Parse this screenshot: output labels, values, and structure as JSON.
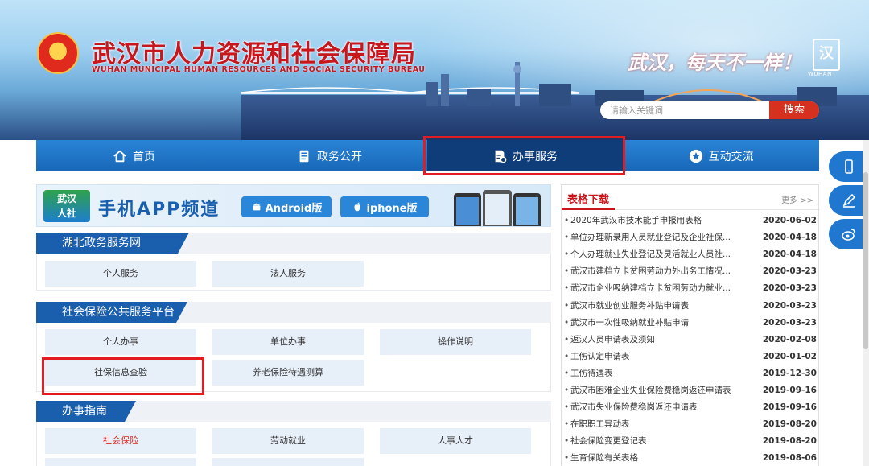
{
  "header": {
    "title": "武汉市人力资源和社会保障局",
    "subtitle": "WUHAN MUNICIPAL HUMAN RESOURCES AND SOCIAL SECURITY BUREAU",
    "slogan": "武汉，每天不一样！",
    "city_logo_text": "WUHAN",
    "search_placeholder": "请输入关键词",
    "search_button": "搜索"
  },
  "nav": {
    "items": [
      {
        "label": "首页",
        "icon": "home-icon"
      },
      {
        "label": "政务公开",
        "icon": "document-icon"
      },
      {
        "label": "办事服务",
        "icon": "service-icon"
      },
      {
        "label": "互动交流",
        "icon": "star-icon"
      }
    ],
    "active_index": 2
  },
  "app_banner": {
    "logo_text_1": "武汉",
    "logo_text_2": "人社",
    "title": "手机APP频道",
    "android_label": "Android版",
    "iphone_label": "iphone版"
  },
  "sections": [
    {
      "title": "湖北政务服务网",
      "tiles": [
        "个人服务",
        "法人服务"
      ]
    },
    {
      "title": "社会保险公共服务平台",
      "tiles": [
        "个人办事",
        "单位办事",
        "操作说明",
        "社保信息查验",
        "养老保险待遇测算"
      ]
    },
    {
      "title": "办事指南",
      "tiles": [
        "社会保险",
        "劳动就业",
        "人事人才"
      ]
    }
  ],
  "downloads": {
    "title": "表格下载",
    "more": "更多 >>",
    "items": [
      {
        "name": "2020年武汉市技术能手申报用表格",
        "date": "2020-06-02"
      },
      {
        "name": "单位办理新录用人员就业登记及企业社保...",
        "date": "2020-04-18"
      },
      {
        "name": "个人办理就业失业登记及灵活就业人员社...",
        "date": "2020-04-18"
      },
      {
        "name": "武汉市建档立卡贫困劳动力外出务工情况...",
        "date": "2020-03-23"
      },
      {
        "name": "武汉市企业吸纳建档立卡贫困劳动力就业...",
        "date": "2020-03-23"
      },
      {
        "name": "武汉市就业创业服务补贴申请表",
        "date": "2020-03-23"
      },
      {
        "name": "武汉市一次性吸纳就业补贴申请",
        "date": "2020-03-23"
      },
      {
        "name": "返汉人员申请表及须知",
        "date": "2020-02-08"
      },
      {
        "name": "工伤认定申请表",
        "date": "2020-01-02"
      },
      {
        "name": "工伤待遇表",
        "date": "2019-12-30"
      },
      {
        "name": "武汉市困难企业失业保险费稳岗返还申请表",
        "date": "2019-09-16"
      },
      {
        "name": "武汉市失业保险费稳岗返还申请表",
        "date": "2019-09-16"
      },
      {
        "name": "在职职工异动表",
        "date": "2019-08-20"
      },
      {
        "name": "社会保险变更登记表",
        "date": "2019-08-20"
      },
      {
        "name": "生育保险有关表格",
        "date": "2019-08-06"
      }
    ]
  },
  "side_icons": [
    "mobile-icon",
    "edit-icon",
    "weibo-icon"
  ],
  "colors": {
    "brand_red": "#c8161d",
    "nav_blue": "#1a6fc4",
    "nav_active": "#0f3d7a",
    "highlight": "#e21c21"
  }
}
